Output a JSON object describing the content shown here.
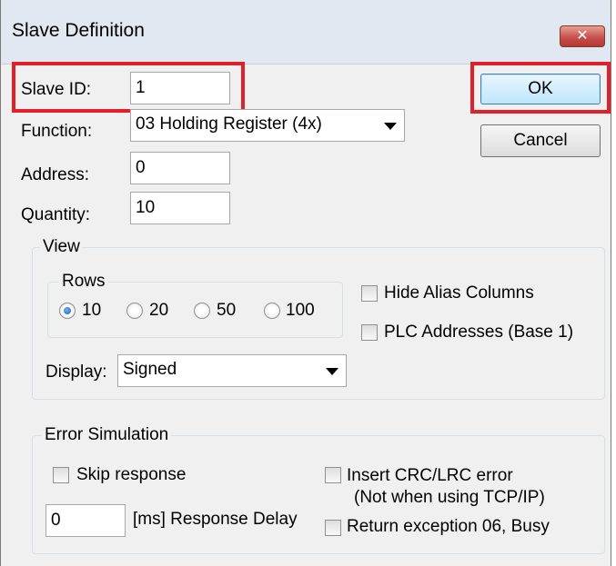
{
  "window": {
    "title": "Slave Definition",
    "close_glyph": "✕"
  },
  "form": {
    "slave_id_label": "Slave ID:",
    "slave_id_value": "1",
    "function_label": "Function:",
    "function_value": "03 Holding Register (4x)",
    "address_label": "Address:",
    "address_value": "0",
    "quantity_label": "Quantity:",
    "quantity_value": "10"
  },
  "buttons": {
    "ok": "OK",
    "cancel": "Cancel"
  },
  "view": {
    "title": "View",
    "rows_title": "Rows",
    "rows_options": [
      "10",
      "20",
      "50",
      "100"
    ],
    "rows_selected": "10",
    "hide_alias_label": "Hide Alias Columns",
    "hide_alias_checked": false,
    "plc_label": "PLC Addresses (Base 1)",
    "plc_checked": false,
    "display_label": "Display:",
    "display_value": "Signed"
  },
  "error_sim": {
    "title": "Error Simulation",
    "skip_label": "Skip response",
    "skip_checked": false,
    "delay_value": "0",
    "delay_label": "[ms] Response Delay",
    "crc_label_line1": "Insert CRC/LRC error",
    "crc_label_line2": "(Not when using TCP/IP)",
    "crc_checked": false,
    "exception_label": "Return exception 06, Busy",
    "exception_checked": false
  },
  "colors": {
    "highlight": "#e0202a",
    "default_button": "#bee6fd"
  }
}
